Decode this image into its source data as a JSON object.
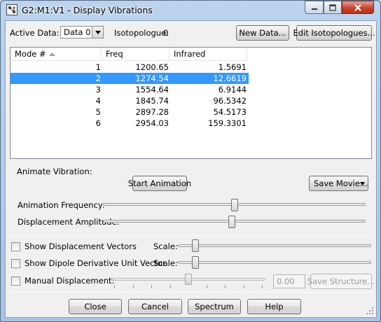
{
  "window": {
    "title": "G2:M1:V1 - Display Vibrations"
  },
  "header": {
    "active_data_label": "Active Data:",
    "active_data_value": "Data 0",
    "isotopologue_label": "Isotopologue:",
    "isotopologue_value": "0",
    "new_data_button": "New Data...",
    "edit_isotopologues_button": "Edit Isotopologues..."
  },
  "table": {
    "columns": [
      "Mode #",
      "Freq",
      "Infrared"
    ],
    "rows": [
      {
        "mode": "1",
        "freq": "1200.65",
        "infrared": "1.5691"
      },
      {
        "mode": "2",
        "freq": "1274.54",
        "infrared": "12.6619"
      },
      {
        "mode": "3",
        "freq": "1554.64",
        "infrared": "6.9144"
      },
      {
        "mode": "4",
        "freq": "1845.74",
        "infrared": "96.5342"
      },
      {
        "mode": "5",
        "freq": "2897.28",
        "infrared": "54.5173"
      },
      {
        "mode": "6",
        "freq": "2954.03",
        "infrared": "159.3301"
      }
    ],
    "selected_row": 2
  },
  "animate": {
    "section_label": "Animate Vibration:",
    "start_button": "Start Animation",
    "save_movie_button": "Save Movie...",
    "frequency_label": "Animation Frequency:",
    "frequency_level": 0.5,
    "amplitude_label": "Displacement Amplitude:",
    "amplitude_level": 0.49
  },
  "options": {
    "show_displacement_vectors": {
      "label": "Show Displacement Vectors",
      "checked": false,
      "scale_label": "Scale:",
      "scale_level": 0.09
    },
    "show_dipole_derivative": {
      "label": "Show Dipole Derivative Unit Vector",
      "checked": false,
      "scale_label": "Scale:",
      "scale_level": 0.09
    },
    "manual_displacement": {
      "label": "Manual Displacement:",
      "checked": false,
      "value": "0.00",
      "level": 0.5
    },
    "save_structure_button": "Save Structure..."
  },
  "footer": {
    "close_button": "Close",
    "cancel_button": "Cancel",
    "spectrum_button": "Spectrum",
    "help_button": "Help"
  },
  "colors": {
    "selection": "#3399ff",
    "title_bar": "#bcd3ec",
    "close_button": "#c9442c"
  }
}
